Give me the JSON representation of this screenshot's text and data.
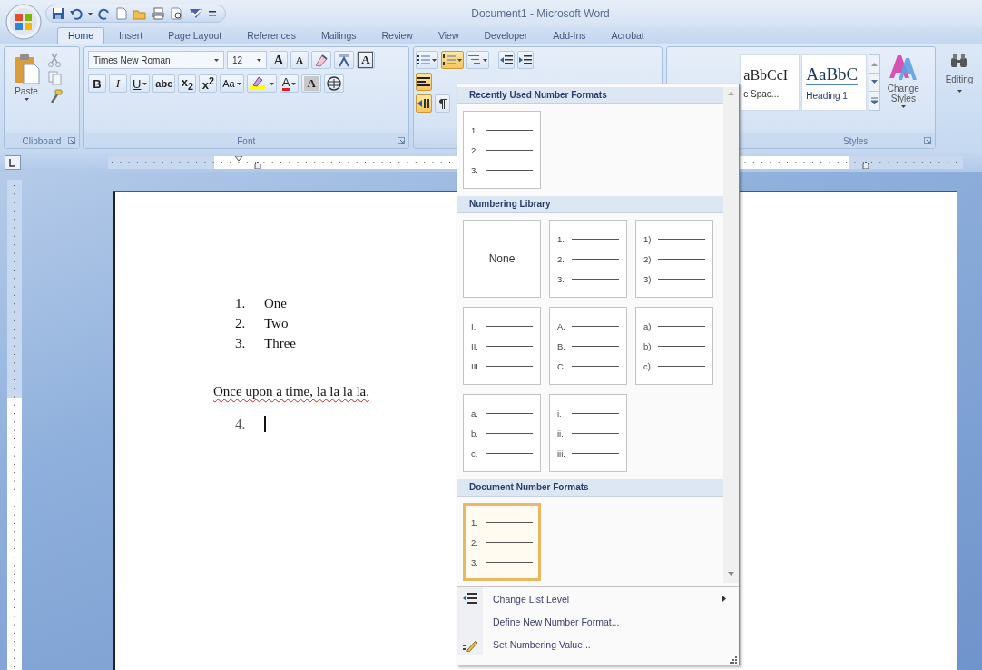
{
  "window": {
    "title": "Document1 - Microsoft Word"
  },
  "ribbon_tabs": [
    {
      "label": "Home",
      "selected": true
    },
    {
      "label": "Insert",
      "selected": false
    },
    {
      "label": "Page Layout",
      "selected": false
    },
    {
      "label": "References",
      "selected": false
    },
    {
      "label": "Mailings",
      "selected": false
    },
    {
      "label": "Review",
      "selected": false
    },
    {
      "label": "View",
      "selected": false
    },
    {
      "label": "Developer",
      "selected": false
    },
    {
      "label": "Add-Ins",
      "selected": false
    },
    {
      "label": "Acrobat",
      "selected": false
    }
  ],
  "clipboard": {
    "paste_label": "Paste",
    "group_label": "Clipboard"
  },
  "font": {
    "name": "Times New Roman",
    "size": "12",
    "group_label": "Font",
    "row_1": [
      {
        "kind": "grow",
        "label": "A"
      },
      {
        "kind": "shrink",
        "label": "A"
      },
      {
        "kind": "clear"
      },
      {
        "kind": "phonetic"
      },
      {
        "kind": "border",
        "label": "A"
      }
    ],
    "row_2": [
      {
        "kind": "bold",
        "label": "B"
      },
      {
        "kind": "italic",
        "label": "I"
      },
      {
        "kind": "underline",
        "label": "U"
      },
      {
        "kind": "strike",
        "label": "abc"
      },
      {
        "kind": "sub",
        "label": "x$_{2}$"
      },
      {
        "kind": "super",
        "label": "x$^{2}$"
      },
      {
        "kind": "case",
        "label": "Aa"
      },
      {
        "kind": "highlight"
      },
      {
        "kind": "color",
        "label": "A"
      },
      {
        "kind": "shade",
        "label": "A"
      },
      {
        "kind": "enclose"
      }
    ]
  },
  "paragraph": {
    "row_1": [
      {
        "kind": "bullets",
        "on": false
      },
      {
        "kind": "numbering",
        "on": true
      },
      {
        "kind": "multilevel",
        "on": false
      },
      {
        "kind": "outdent",
        "on": false
      },
      {
        "kind": "indent",
        "on": false
      }
    ],
    "row_2": [
      {
        "kind": "align",
        "on": true
      }
    ],
    "row_3": [
      {
        "kind": "direction",
        "on": true
      },
      {
        "kind": "marks",
        "on": false
      }
    ]
  },
  "styles": {
    "group_label": "Styles",
    "gallery": [
      {
        "preview": "aBbCcI",
        "label": "c Spac..."
      },
      {
        "preview": "AaBbC",
        "label": "Heading 1"
      }
    ],
    "change_styles": "Change Styles"
  },
  "editing": {
    "label": "Editing"
  },
  "document": {
    "list": [
      {
        "number": "1.",
        "text": "One"
      },
      {
        "number": "2.",
        "text": "Two"
      },
      {
        "number": "3.",
        "text": "Three"
      }
    ],
    "paragraph": {
      "text": "Once upon a time, la la la la.",
      "flagged": true
    },
    "current_item": {
      "number": "4."
    }
  },
  "numbering_menu": {
    "sections": [
      {
        "title": "Recently Used Number Formats",
        "tiles": [
          {
            "kind": "list",
            "markers": [
              "1.",
              "2.",
              "3."
            ],
            "selected": false
          }
        ]
      },
      {
        "title": "Numbering Library",
        "tiles": [
          {
            "kind": "none",
            "label": "None",
            "selected": false
          },
          {
            "kind": "list",
            "markers": [
              "1.",
              "2.",
              "3."
            ],
            "selected": false
          },
          {
            "kind": "list",
            "markers": [
              "1)",
              "2)",
              "3)"
            ],
            "selected": false
          },
          {
            "kind": "list",
            "markers": [
              "I.",
              "II.",
              "III."
            ],
            "selected": false
          },
          {
            "kind": "list",
            "markers": [
              "A.",
              "B.",
              "C."
            ],
            "selected": false
          },
          {
            "kind": "list",
            "markers": [
              "a)",
              "b)",
              "c)"
            ],
            "selected": false
          },
          {
            "kind": "list",
            "markers": [
              "a.",
              "b.",
              "c."
            ],
            "selected": false
          },
          {
            "kind": "list",
            "markers": [
              "i.",
              "ii.",
              "iii."
            ],
            "selected": false
          }
        ]
      },
      {
        "title": "Document Number Formats",
        "tiles": [
          {
            "kind": "list",
            "markers": [
              "1.",
              "2.",
              "3."
            ],
            "selected": true
          }
        ]
      }
    ],
    "commands": [
      {
        "label": "Change List Level",
        "submenu": true
      },
      {
        "label": "Define New Number Format...",
        "submenu": false
      },
      {
        "label": "Set Numbering Value...",
        "submenu": false
      }
    ]
  }
}
